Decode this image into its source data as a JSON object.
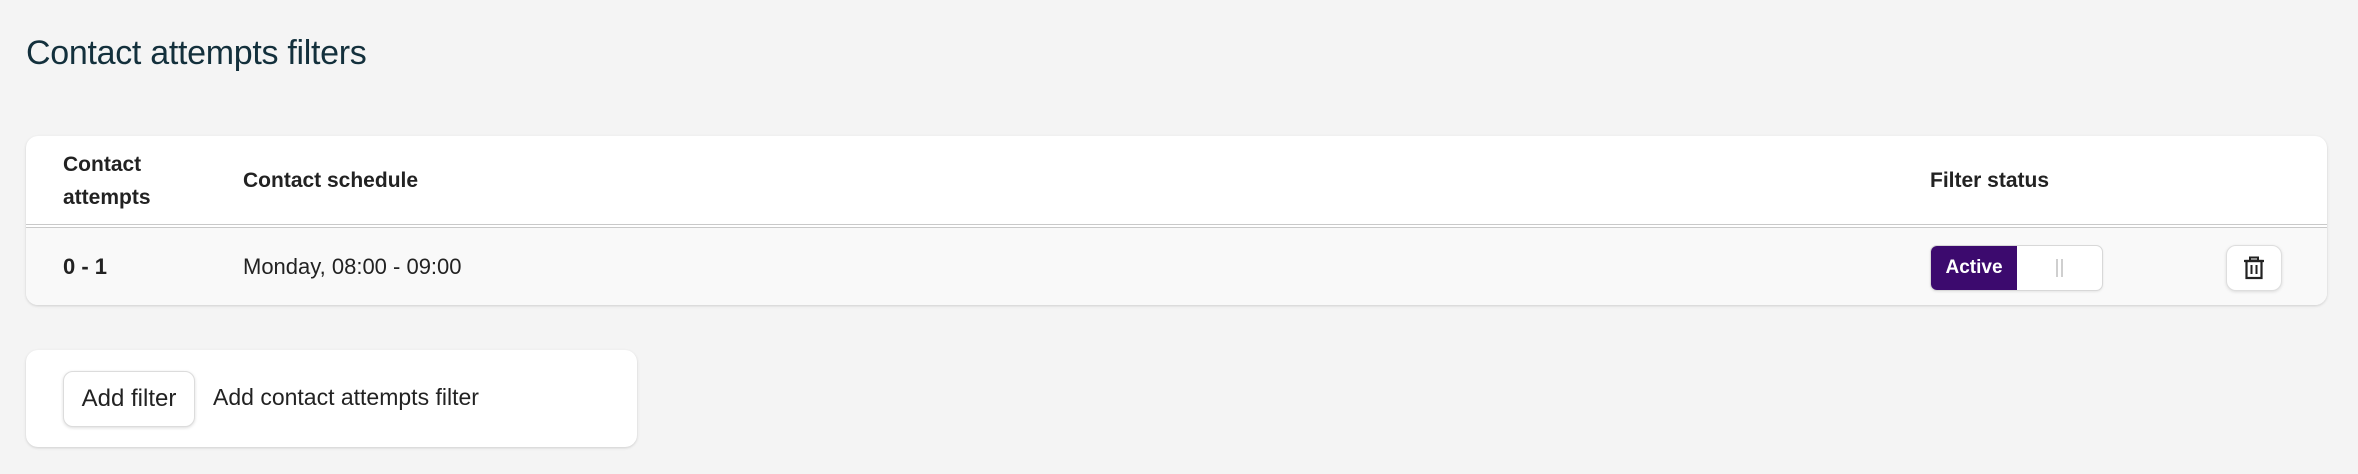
{
  "page": {
    "title": "Contact attempts filters"
  },
  "table": {
    "headers": {
      "attempts": "Contact attempts",
      "schedule": "Contact schedule",
      "status": "Filter status"
    },
    "rows": [
      {
        "attempts": "0 - 1",
        "schedule": "Monday, 08:00 - 09:00",
        "status_label": "Active",
        "status_active": true
      }
    ]
  },
  "add_filter": {
    "button_label": "Add filter",
    "description": "Add contact attempts filter"
  },
  "icons": {
    "delete": "trash-icon",
    "inactive": "pause-icon"
  },
  "colors": {
    "accent": "#3c0a6e",
    "title": "#13303c",
    "background": "#f4f4f4"
  }
}
